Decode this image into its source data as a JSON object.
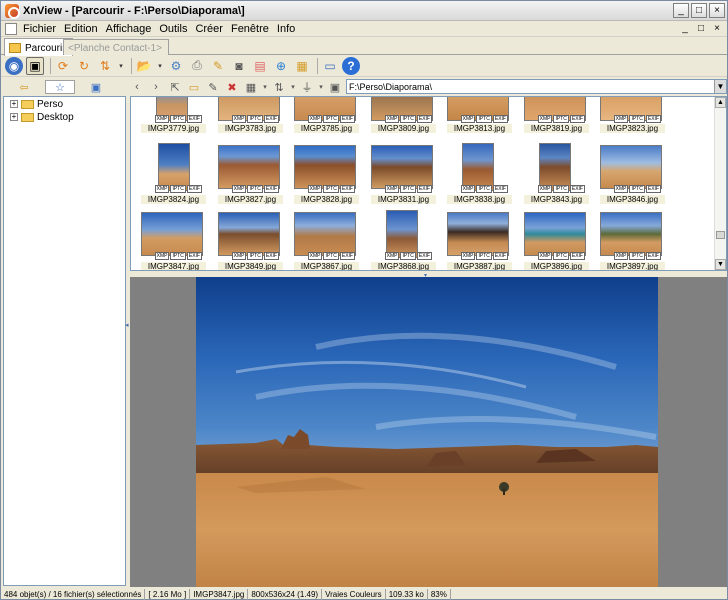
{
  "window": {
    "title": "XnView - [Parcourir - F:\\Perso\\Diaporama\\]",
    "controls": [
      "_",
      "□",
      "×"
    ]
  },
  "menu": {
    "items": [
      "Fichier",
      "Edition",
      "Affichage",
      "Outils",
      "Créer",
      "Fenêtre",
      "Info"
    ],
    "right": [
      "_",
      "□",
      "×"
    ]
  },
  "tabs": [
    {
      "label": "Parcourir",
      "active": true
    },
    {
      "label": "<Planche Contact-1>",
      "active": false
    }
  ],
  "path": {
    "value": "F:\\Perso\\Diaporama\\"
  },
  "tree": {
    "items": [
      {
        "label": "Perso"
      },
      {
        "label": "Desktop"
      }
    ]
  },
  "thumbnails": [
    {
      "name": "IMGP3779.jpg",
      "badges": [
        "XMP",
        "IPTC",
        "EXIF"
      ]
    },
    {
      "name": "IMGP3783.jpg",
      "badges": [
        "XMP",
        "IPTC",
        "EXIF"
      ]
    },
    {
      "name": "IMGP3785.jpg",
      "badges": [
        "XMP",
        "IPTC",
        "EXIF"
      ]
    },
    {
      "name": "IMGP3809.jpg",
      "badges": [
        "XMP",
        "IPTC",
        "EXIF"
      ]
    },
    {
      "name": "IMGP3813.jpg",
      "badges": [
        "XMP",
        "IPTC",
        "EXIF"
      ]
    },
    {
      "name": "IMGP3819.jpg",
      "badges": [
        "XMP",
        "IPTC",
        "EXIF"
      ]
    },
    {
      "name": "IMGP3823.jpg",
      "badges": [
        "XMP",
        "IPTC",
        "EXIF"
      ]
    },
    {
      "name": "IMGP3824.jpg",
      "badges": [
        "XMP",
        "IPTC",
        "EXIF"
      ]
    },
    {
      "name": "IMGP3827.jpg",
      "badges": [
        "XMP",
        "IPTC",
        "EXIF"
      ]
    },
    {
      "name": "IMGP3828.jpg",
      "badges": [
        "XMP",
        "IPTC",
        "EXIF"
      ]
    },
    {
      "name": "IMGP3831.jpg",
      "badges": [
        "XMP",
        "IPTC",
        "EXIF"
      ]
    },
    {
      "name": "IMGP3838.jpg",
      "badges": [
        "XMP",
        "IPTC",
        "EXIF"
      ]
    },
    {
      "name": "IMGP3843.jpg",
      "badges": [
        "XMP",
        "IPTC",
        "EXIF"
      ]
    },
    {
      "name": "IMGP3846.jpg",
      "badges": [
        "XMP",
        "IPTC",
        "EXIF"
      ]
    },
    {
      "name": "IMGP3847.jpg",
      "badges": [
        "XMP",
        "IPTC",
        "EXIF"
      ]
    },
    {
      "name": "IMGP3849.jpg",
      "badges": [
        "XMP",
        "IPTC",
        "EXIF"
      ]
    },
    {
      "name": "IMGP3867.jpg",
      "badges": [
        "XMP",
        "IPTC",
        "EXIF"
      ]
    },
    {
      "name": "IMGP3868.jpg",
      "badges": [
        "XMP",
        "IPTC",
        "EXIF"
      ]
    },
    {
      "name": "IMGP3887.jpg",
      "badges": [
        "XMP",
        "IPTC",
        "EXIF"
      ]
    },
    {
      "name": "IMGP3896.jpg",
      "badges": [
        "XMP",
        "IPTC",
        "EXIF"
      ]
    },
    {
      "name": "IMGP3897.jpg",
      "badges": [
        "XMP",
        "IPTC",
        "EXIF"
      ]
    }
  ],
  "status": {
    "objects": "484 objet(s) / 16 fichier(s) sélectionnés",
    "size": "[ 2.16 Mo ]",
    "file": "IMGP3847.jpg",
    "dims": "800x536x24 (1.49)",
    "color": "Vraies Couleurs",
    "kb": "109.33 ko",
    "zoom": "83%"
  }
}
